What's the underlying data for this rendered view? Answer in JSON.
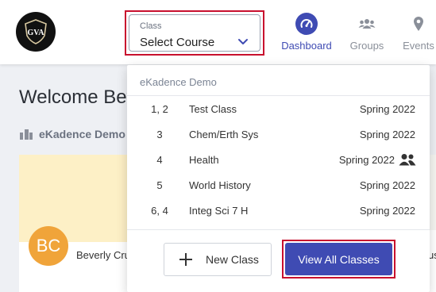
{
  "header": {
    "logo_text": "GVA",
    "class_select": {
      "label": "Class",
      "value": "Select Course"
    },
    "nav": [
      {
        "label": "Dashboard",
        "icon": "dashboard-gauge-icon",
        "active": true
      },
      {
        "label": "Groups",
        "icon": "groups-icon",
        "active": false
      },
      {
        "label": "Events",
        "icon": "map-pin-icon",
        "active": false
      }
    ]
  },
  "page": {
    "welcome": "Welcome Bev",
    "org_name": "eKadence Demo",
    "card_name": "Beverly Cru",
    "avatar_initials": "BC",
    "right_card_text": "us"
  },
  "dropdown": {
    "header": "eKadence Demo",
    "rows": [
      {
        "num": "1, 2",
        "name": "Test Class",
        "term": "Spring 2022",
        "group": false
      },
      {
        "num": "3",
        "name": "Chem/Erth Sys",
        "term": "Spring 2022",
        "group": false
      },
      {
        "num": "4",
        "name": "Health",
        "term": "Spring 2022",
        "group": true
      },
      {
        "num": "5",
        "name": "World History",
        "term": "Spring 2022",
        "group": false
      },
      {
        "num": "6, 4",
        "name": "Integ Sci 7 H",
        "term": "Spring 2022",
        "group": false
      }
    ],
    "new_class_label": "New Class",
    "view_all_label": "View All Classes"
  },
  "colors": {
    "accent": "#3f4bb3",
    "highlight_outline": "#c8102e",
    "avatar": "#f0a43a",
    "card_banner": "#fdf0c6"
  }
}
